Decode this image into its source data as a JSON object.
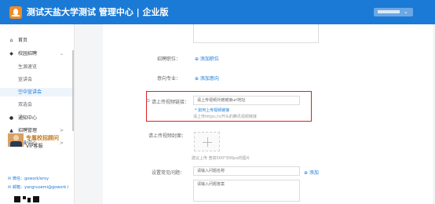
{
  "header": {
    "title": "测试天盐大学测试 管理中心 | 企业版",
    "user_caret": "⌄"
  },
  "sidebar": {
    "items": [
      {
        "icon": "⌂",
        "label": "首页"
      },
      {
        "icon": "◆",
        "label": "校园招聘",
        "arrow": "⌄"
      },
      {
        "icon": "●",
        "label": "通知中心"
      },
      {
        "icon": "▲",
        "label": "招聘管理",
        "arrow": ">"
      },
      {
        "icon": "▦",
        "label": "企业中心",
        "arrow": ">"
      }
    ],
    "sub_items": [
      "生源速览",
      "宣讲会",
      "空中宣讲会",
      "双选会"
    ],
    "active_sub": "空中宣讲会",
    "vip": {
      "title": "专属校招顾问",
      "subtitle": "VIP客服"
    },
    "contacts": [
      {
        "icon": "✉",
        "text": "微信：gowork/eroy"
      },
      {
        "icon": "✉",
        "text": "邮箱：yangruoemi@gowork.l"
      }
    ]
  },
  "form": {
    "position_label": "招聘职位：",
    "position_add": "⊕ 添加职位",
    "major_label": "意向专业：",
    "major_add": "⊕ 添加意向",
    "video_label": "请上传视频链接：",
    "video_required_mark": "⊙",
    "video_placeholder": "请上传视频外链链接url地址",
    "video_help_link": "* 如何上传视频链接",
    "video_help_hint": "请上传https://v开头的腾讯视频链接",
    "cover_label": "请上传视频封面：",
    "cover_hint": "建议上传 宽高500*300px的图片",
    "question_label": "设置常见问题：",
    "question_name_placeholder": "请输入问题名称",
    "question_add": "⊕ 添加",
    "answer_placeholder": "请输入问题答案"
  },
  "colors": {
    "header": "#1b7ad6",
    "accent": "#1b7ad6",
    "highlight": "#e02020",
    "logo": "#f08a24"
  },
  "icons": {
    "logo": "flame-logo-icon",
    "home": "home-icon",
    "campus": "graduation-icon",
    "notice": "bell-icon",
    "recruit": "user-icon",
    "enterprise": "building-icon"
  }
}
